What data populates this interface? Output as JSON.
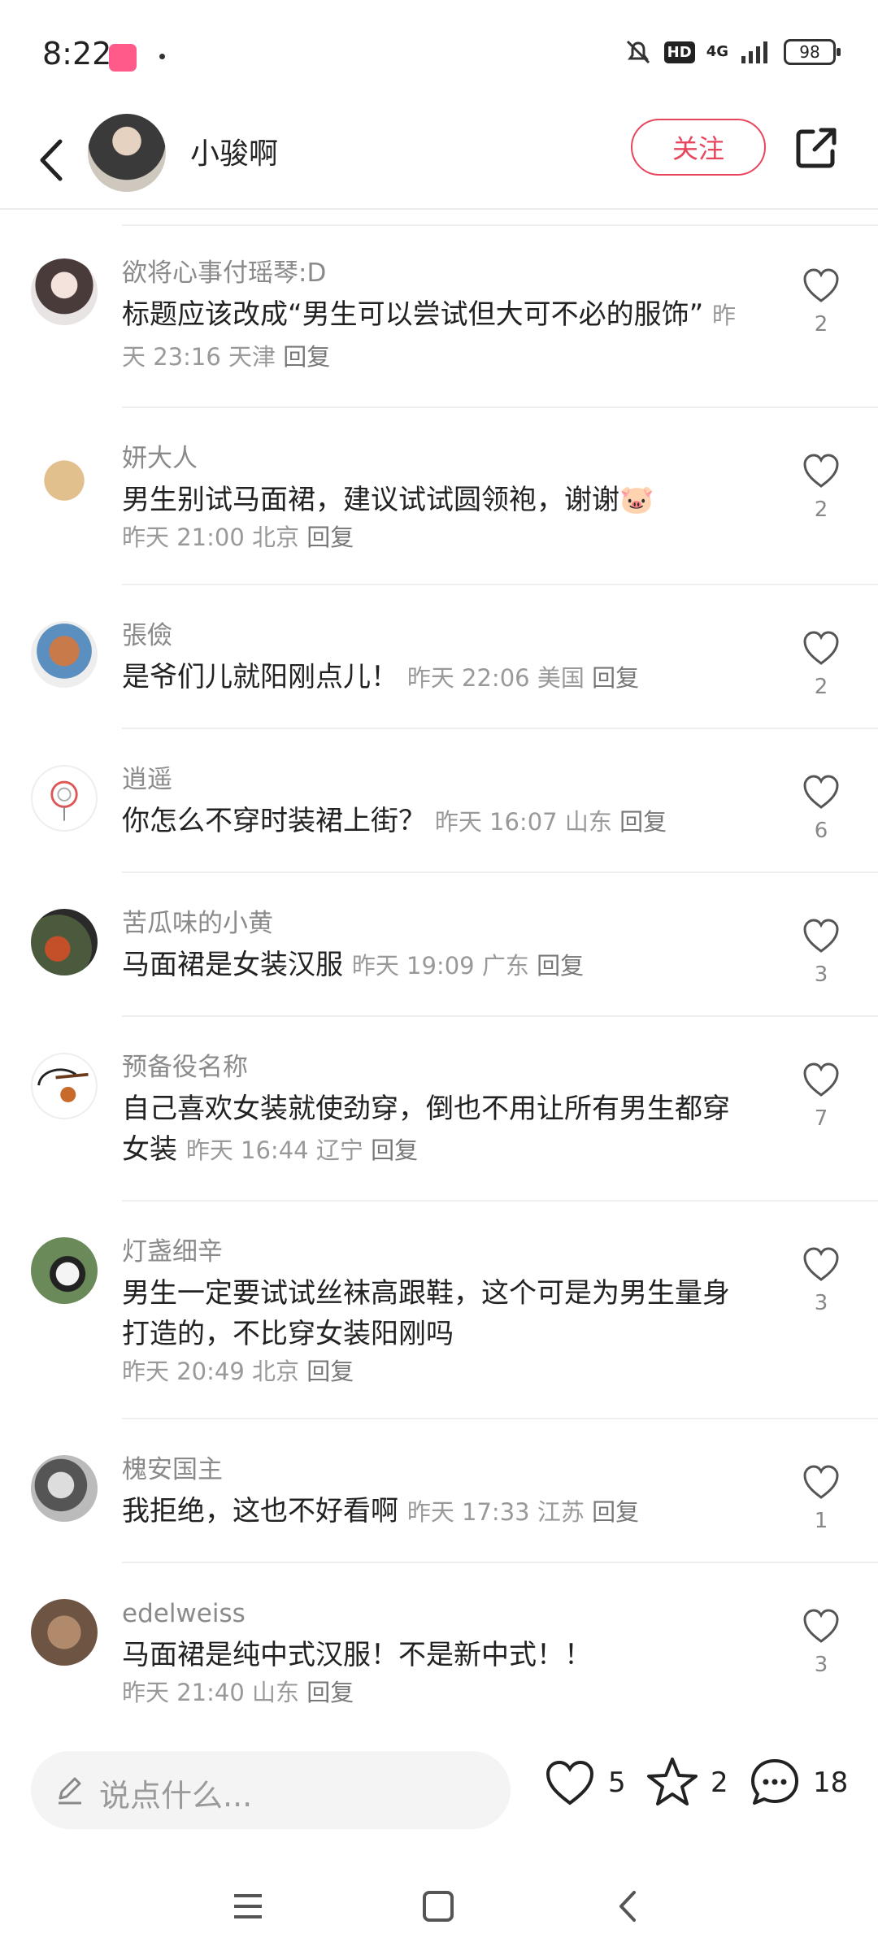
{
  "status": {
    "time": "8:22",
    "network": "4G",
    "hd": "HD",
    "battery": "98"
  },
  "header": {
    "author": "小骏啊",
    "follow_label": "关注"
  },
  "comments": [
    {
      "name": "欲将心事付瑶琴:D",
      "text": "标题应该改成“男生可以尝试但大可不必的服饰”",
      "time": "昨天 23:16",
      "location": "天津",
      "reply": "回复",
      "likes": "2"
    },
    {
      "name": "妍大人",
      "text": "男生别试马面裙，建议试试圆领袍，谢谢",
      "emoji": "🐷",
      "time": "昨天 21:00",
      "location": "北京",
      "reply": "回复",
      "likes": "2"
    },
    {
      "name": "張儉",
      "text": "是爷们儿就阳刚点儿！",
      "time": "昨天 22:06",
      "location": "美国",
      "reply": "回复",
      "likes": "2"
    },
    {
      "name": "逍遥",
      "text": "你怎么不穿时装裙上街？",
      "time": "昨天 16:07",
      "location": "山东",
      "reply": "回复",
      "likes": "6"
    },
    {
      "name": "苦瓜味的小黄",
      "text": "马面裙是女装汉服",
      "time": "昨天 19:09",
      "location": "广东",
      "reply": "回复",
      "likes": "3"
    },
    {
      "name": "预备役名称",
      "text": "自己喜欢女装就使劲穿，倒也不用让所有男生都穿女装",
      "time": "昨天 16:44",
      "location": "辽宁",
      "reply": "回复",
      "likes": "7"
    },
    {
      "name": "灯盏细辛",
      "text": "男生一定要试试丝袜高跟鞋，这个可是为男生量身打造的，不比穿女装阳刚吗",
      "time": "昨天 20:49",
      "location": "北京",
      "reply": "回复",
      "likes": "3"
    },
    {
      "name": "槐安国主",
      "text": "我拒绝，这也不好看啊",
      "time": "昨天 17:33",
      "location": "江苏",
      "reply": "回复",
      "likes": "1"
    },
    {
      "name": "edelweiss",
      "text": "马面裙是纯中式汉服！不是新中式！！",
      "time": "昨天 21:40",
      "location": "山东",
      "reply": "回复",
      "likes": "3"
    }
  ],
  "bottom": {
    "placeholder": "说点什么...",
    "likes": "5",
    "favorites": "2",
    "comments": "18"
  },
  "colors": {
    "accent": "#e8455d"
  },
  "icons": [
    "back-icon",
    "share-icon",
    "heart-icon",
    "star-icon",
    "comment-icon",
    "pen-icon"
  ]
}
